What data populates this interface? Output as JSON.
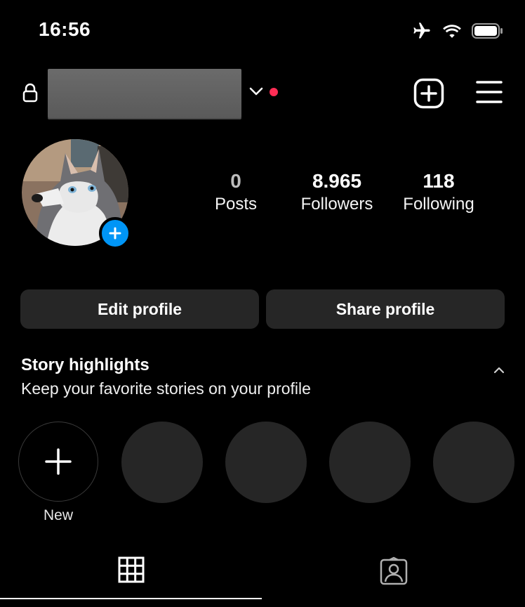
{
  "status_bar": {
    "time": "16:56",
    "icons": [
      "airplane-mode-icon",
      "wifi-icon",
      "battery-icon"
    ]
  },
  "header": {
    "username": "",
    "icons": [
      "lock-icon",
      "chevron-down-icon",
      "create-post-icon",
      "menu-icon"
    ],
    "notification_dot_color": "#ff2d55"
  },
  "profile": {
    "stats": [
      {
        "value": "0",
        "label": "Posts"
      },
      {
        "value": "8.965",
        "label": "Followers"
      },
      {
        "value": "118",
        "label": "Following"
      }
    ]
  },
  "actions": {
    "edit_label": "Edit profile",
    "share_label": "Share profile"
  },
  "highlights": {
    "title": "Story highlights",
    "subtitle": "Keep your favorite stories on your profile",
    "new_label": "New"
  },
  "tabs": [
    "grid-icon",
    "tagged-icon"
  ],
  "colors": {
    "background": "#000000",
    "button": "#262626",
    "accent": "#0095f6"
  }
}
